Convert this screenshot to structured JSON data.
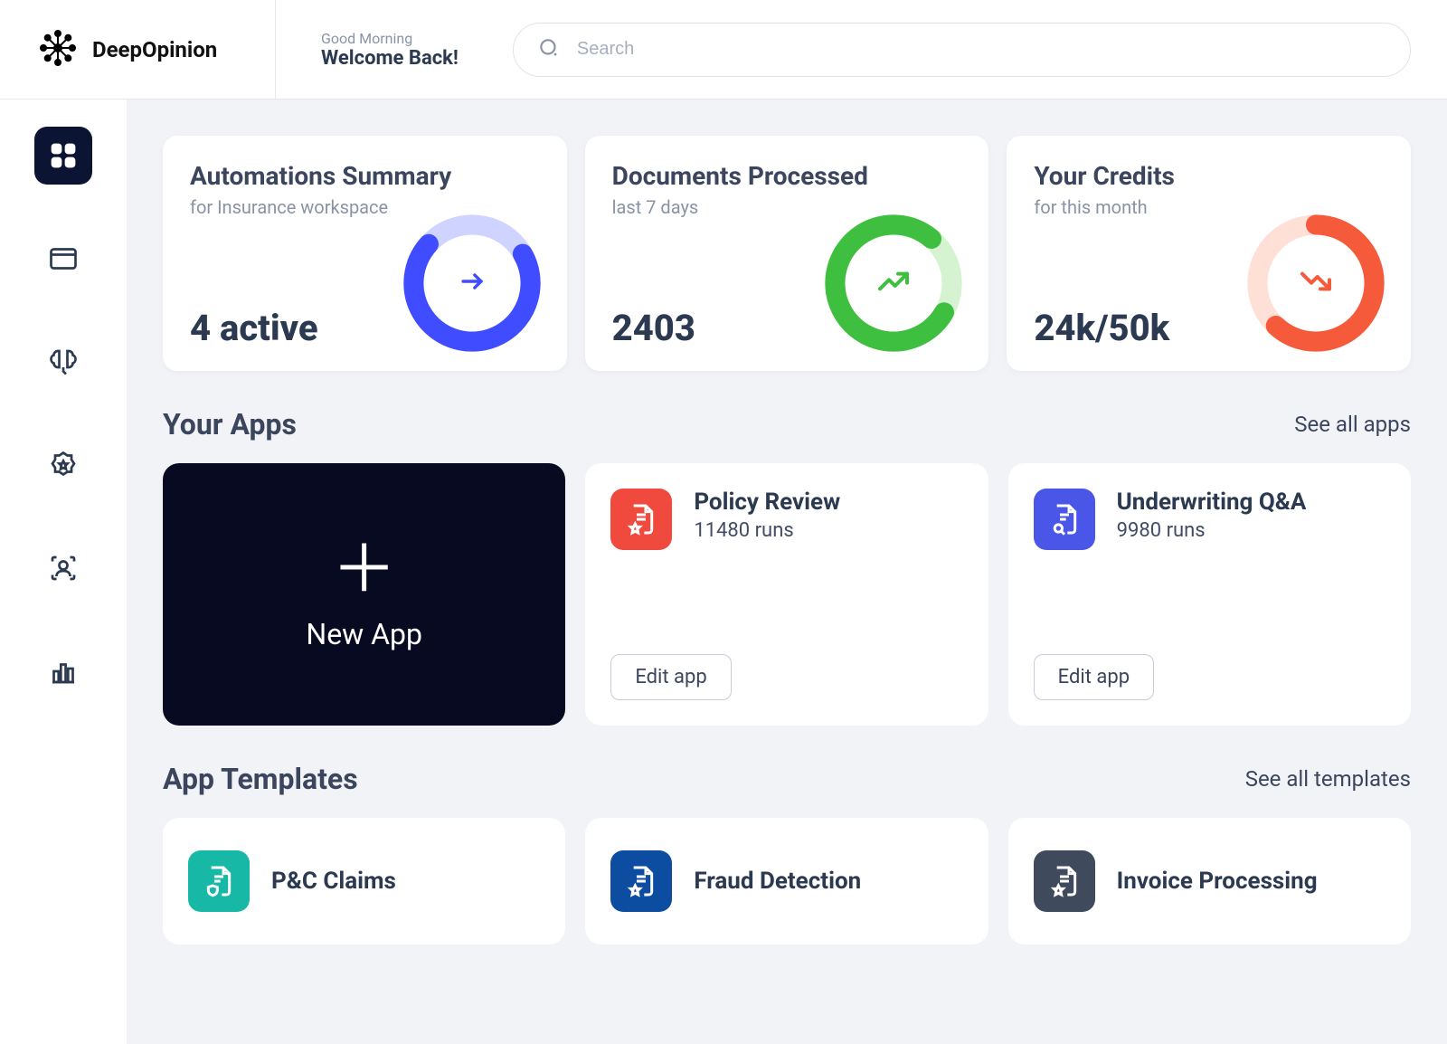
{
  "brand": {
    "name": "DeepOpinion"
  },
  "header": {
    "greeting": "Good Morning",
    "welcome": "Welcome Back!",
    "search_placeholder": "Search"
  },
  "summary_cards": {
    "automations": {
      "title": "Automations Summary",
      "subtitle": "for Insurance workspace",
      "value": "4 active",
      "ring_color": "#3f4cff",
      "ring_bg": "#cfd3ff",
      "ring_percent": 70
    },
    "documents": {
      "title": "Documents Processed",
      "subtitle": "last 7 days",
      "value": "2403",
      "ring_color": "#3fbf3f",
      "ring_bg": "#d6f3d1",
      "ring_percent": 78
    },
    "credits": {
      "title": "Your Credits",
      "subtitle": "for this month",
      "value": "24k/50k",
      "ring_color": "#f55a3a",
      "ring_bg": "#ffe0d6",
      "ring_percent": 62
    }
  },
  "sections": {
    "apps_title": "Your Apps",
    "apps_link": "See all apps",
    "templates_title": "App Templates",
    "templates_link": "See all templates"
  },
  "new_app_label": "New App",
  "apps": [
    {
      "name": "Policy Review",
      "runs": "11480 runs",
      "icon_bg": "#f04a3e",
      "edit_label": "Edit app"
    },
    {
      "name": "Underwriting Q&A",
      "runs": "9980 runs",
      "icon_bg": "#4a56e8",
      "edit_label": "Edit app"
    }
  ],
  "templates": [
    {
      "name": "P&C Claims",
      "icon_bg": "#17b8a6"
    },
    {
      "name": "Fraud Detection",
      "icon_bg": "#0d4da1"
    },
    {
      "name": "Invoice Processing",
      "icon_bg": "#3f4a5c"
    }
  ]
}
